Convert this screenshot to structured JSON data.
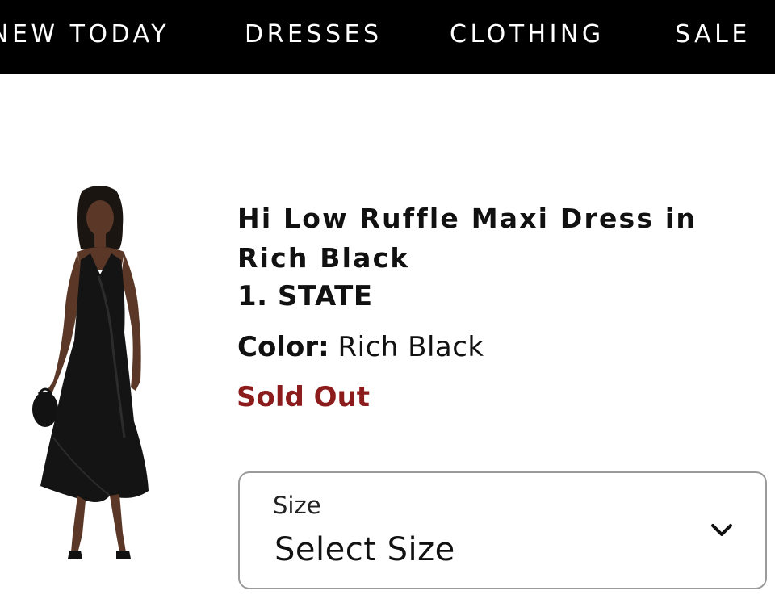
{
  "nav": {
    "items": [
      {
        "label": "NEW TODAY"
      },
      {
        "label": "DRESSES"
      },
      {
        "label": "CLOTHING"
      },
      {
        "label": "SALE"
      }
    ]
  },
  "product": {
    "title": "Hi Low Ruffle Maxi Dress in Rich Black",
    "brand": "1. STATE",
    "color_label": "Color:",
    "color_value": "Rich Black",
    "status": "Sold Out",
    "image_icon": "product-photo-black-dress"
  },
  "size_selector": {
    "label": "Size",
    "value": "Select Size",
    "icon": "chevron-down-icon"
  },
  "colors": {
    "nav_bg": "#000000",
    "nav_text": "#ffffff",
    "sold_out": "#8c1c1c",
    "border": "#9a9a9a"
  }
}
